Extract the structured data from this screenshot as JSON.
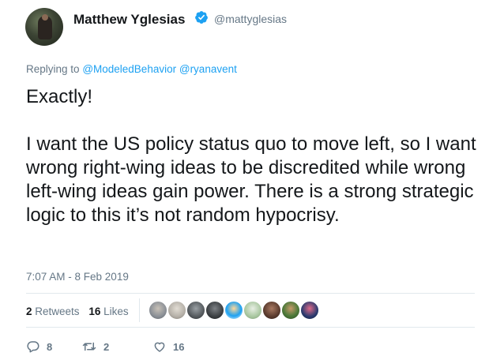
{
  "author": {
    "name": "Matthew Yglesias",
    "handle": "@mattyglesias",
    "verified": true
  },
  "reply": {
    "prefix": "Replying to",
    "mentions": [
      "@ModeledBehavior",
      "@ryanavent"
    ]
  },
  "tweet": {
    "text": "Exactly!\n\nI want the US policy status quo to move left, so I want wrong right-wing ideas to be discredited while wrong left-wing ideas gain power. There is a strong strategic logic to this it’s not random hypocrisy."
  },
  "timestamp": "7:07 AM - 8 Feb 2019",
  "stats": {
    "retweets_count": "2",
    "retweets_label": "Retweets",
    "likes_count": "16",
    "likes_label": "Likes"
  },
  "actions": {
    "reply_count": "8",
    "retweet_count": "2",
    "like_count": "16"
  },
  "colors": {
    "accent": "#1da1f2",
    "muted": "#657786",
    "text": "#14171a"
  },
  "liker_avatar_colors": [
    "#8a8f96",
    "#b5b0a8",
    "#555a5e",
    "#3b3f42",
    "#1da1f2",
    "#a9c7a0",
    "#5a3b2e",
    "#4e7a3a",
    "#2a3a6e"
  ]
}
